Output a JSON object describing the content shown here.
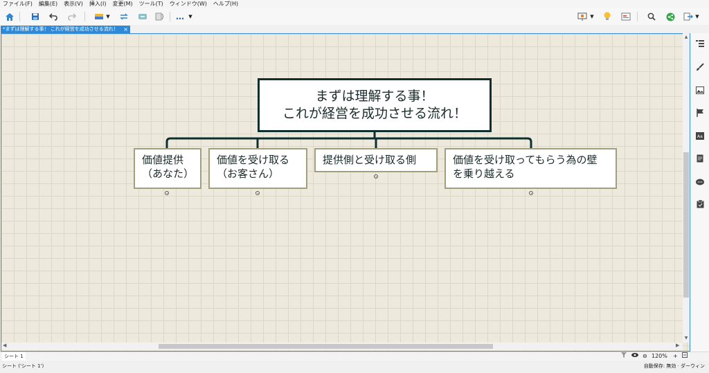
{
  "menu": [
    "ファイル(F)",
    "編集(E)",
    "表示(V)",
    "挿入(I)",
    "変更(M)",
    "ツール(T)",
    "ウィンドウ(W)",
    "ヘルプ(H)"
  ],
  "toolbar": {
    "home_icon": "house-icon",
    "save_icon": "floppy-icon",
    "undo_icon": "undo-icon",
    "redo_icon": "redo-icon",
    "more_label": "…",
    "right_icons": [
      "presentation-icon",
      "lightbulb-icon",
      "outline-icon",
      "search-icon",
      "share-icon",
      "export-icon"
    ]
  },
  "tab": {
    "title": "*まずは理解する事！ これが経営を成功させる流れ！",
    "close": "×"
  },
  "mindmap": {
    "central": {
      "line1": "まずは理解する事！",
      "line2": "これが経営を成功させる流れ！"
    },
    "topics": [
      {
        "line1": "価値提供",
        "line2": "（あなた）"
      },
      {
        "line1": "価値を受け取る",
        "line2": "（お客さん）"
      },
      {
        "line1": "提供側と受け取る側",
        "line2": ""
      },
      {
        "line1": "価値を受け取ってもらう為の壁",
        "line2": "を乗り越える"
      }
    ],
    "colors": {
      "central_border": "#0f2f2f",
      "topic_border": "#a39e7e",
      "canvas": "#ede9dc"
    }
  },
  "right_panel": [
    "outline-panel-icon",
    "brush-icon",
    "image-icon",
    "flag-icon",
    "font-icon",
    "note-icon",
    "comment-icon",
    "task-icon"
  ],
  "sheetbar": {
    "sheet_tab": "シート 1",
    "zoom": "120%",
    "zoom_out": "⊖",
    "zoom_in": "+"
  },
  "status": {
    "left": "シート ('シート 1')",
    "right": "自動保存: 無効 · ダーウィン"
  }
}
